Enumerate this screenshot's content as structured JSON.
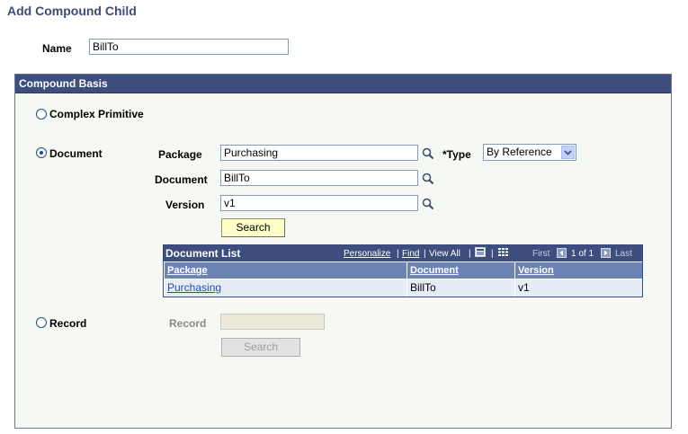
{
  "page": {
    "title": "Add Compound Child"
  },
  "name_field": {
    "label": "Name",
    "value": "BillTo"
  },
  "compound_basis": {
    "header": "Compound Basis",
    "options": {
      "complex_primitive": "Complex Primitive",
      "document": "Document",
      "record": "Record"
    },
    "selected": "document"
  },
  "document": {
    "package_label": "Package",
    "package_value": "Purchasing",
    "type_label": "*Type",
    "type_value": "By Reference",
    "document_label": "Document",
    "document_value": "BillTo",
    "version_label": "Version",
    "version_value": "v1",
    "search_label": "Search"
  },
  "document_list": {
    "title": "Document List",
    "nav": {
      "personalize": "Personalize",
      "sep1": "|",
      "find": "Find",
      "sep2": "|",
      "view_all": "View All",
      "sep3": "|",
      "sep4": "|",
      "first": "First",
      "range": "1 of 1",
      "last": "Last"
    },
    "columns": [
      "Package",
      "Document",
      "Version"
    ],
    "rows": [
      {
        "package": "Purchasing",
        "document": "BillTo",
        "version": "v1"
      }
    ]
  },
  "record": {
    "label": "Record",
    "value": "",
    "search_label": "Search"
  },
  "colors": {
    "header_bg": "#3c4d7e",
    "title_color": "#3c4c78",
    "button_bg": "#ffffc8"
  }
}
